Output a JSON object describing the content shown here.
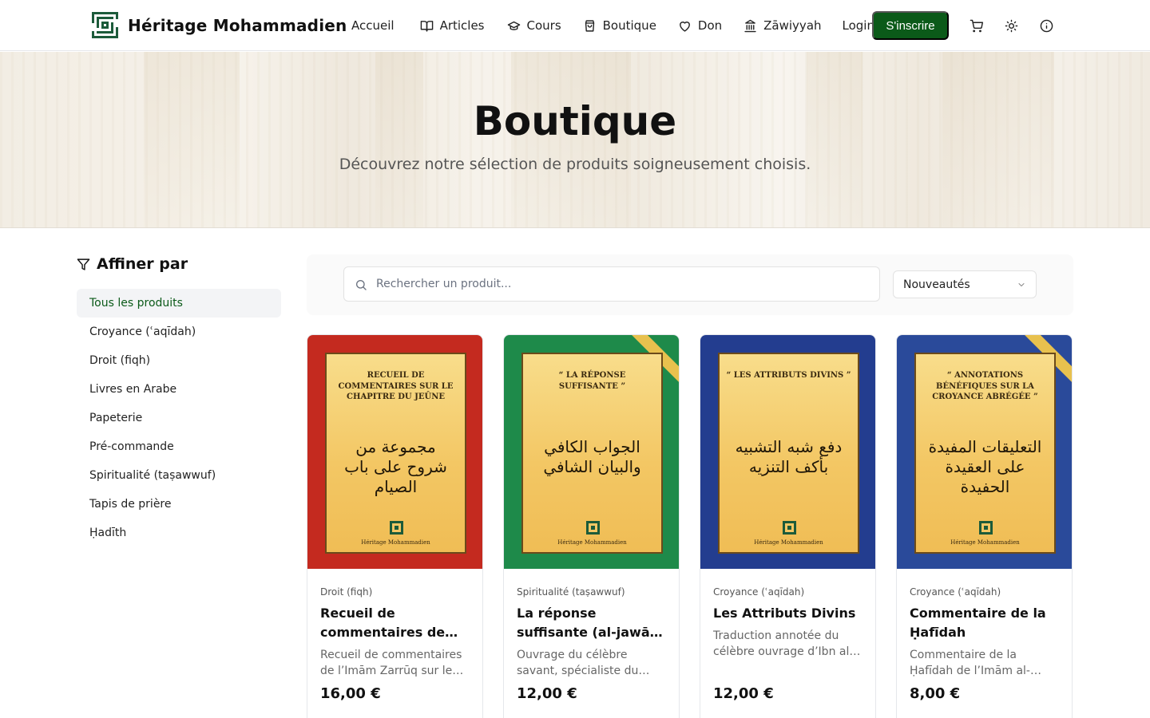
{
  "brand": {
    "name": "Héritage Mohammadien",
    "logo_icon": "kufic-square-logo"
  },
  "nav": {
    "items": [
      {
        "label": "Accueil",
        "icon": ""
      },
      {
        "label": "Articles",
        "icon": "book-open-icon"
      },
      {
        "label": "Cours",
        "icon": "graduation-cap-icon"
      },
      {
        "label": "Boutique",
        "icon": "shopping-bag-icon"
      },
      {
        "label": "Don",
        "icon": "heart-icon"
      },
      {
        "label": "Zāwiyyah",
        "icon": "landmark-icon"
      },
      {
        "label": "Login",
        "icon": ""
      }
    ],
    "signup_label": "S'inscrire",
    "icons": [
      "cart-icon",
      "sun-icon",
      "info-icon"
    ]
  },
  "hero": {
    "title": "Boutique",
    "subtitle": "Découvrez notre sélection de produits soigneusement choisis."
  },
  "sidebar": {
    "title": "Affiner par",
    "categories": [
      {
        "label": "Tous les produits",
        "active": true
      },
      {
        "label": "Croyance (ʿaqīdah)",
        "active": false
      },
      {
        "label": "Droit (fiqh)",
        "active": false
      },
      {
        "label": "Livres en Arabe",
        "active": false
      },
      {
        "label": "Papeterie",
        "active": false
      },
      {
        "label": "Pré-commande",
        "active": false
      },
      {
        "label": "Spiritualité (taṣawwuf)",
        "active": false
      },
      {
        "label": "Tapis de prière",
        "active": false
      },
      {
        "label": "Ḥadīth",
        "active": false
      }
    ]
  },
  "search": {
    "placeholder": "Rechercher un produit...",
    "value": ""
  },
  "sort": {
    "selected": "Nouveautés"
  },
  "products": [
    {
      "category": "Droit (fiqh)",
      "title": "Recueil de commentaires de l’Imām Zarrūq",
      "description": "Recueil de commentaires de l’Imām Zarrūq sur le chapitre du jeûne",
      "price": "16,00 €",
      "cover_title": "Recueil de commentaires sur le chapitre du jeûne",
      "cover_arabic": "مجموعة من شروح على باب الصيام",
      "cover_publisher": "Héritage Mohammadien",
      "cover_color": "#c42a1f"
    },
    {
      "category": "Spiritualité (taṣawwuf)",
      "title": "La réponse suffisante (al-jawāb al-kāfī)",
      "description": "Ouvrage du célèbre savant, spécialiste du soufisme",
      "price": "12,00 €",
      "cover_title": "“ La réponse suffisante ”",
      "cover_arabic": "الجواب الكافي والبيان الشافي",
      "cover_publisher": "Héritage Mohammadien",
      "cover_color": "#1e8a4a"
    },
    {
      "category": "Croyance (ʿaqīdah)",
      "title": "Les Attributs Divins",
      "description": "Traduction annotée du célèbre ouvrage d’Ibn al-Jawzī",
      "price": "12,00 €",
      "cover_title": "“ Les attributs divins ”",
      "cover_arabic": "دفع شبه التشبيه بأكف التنزيه",
      "cover_publisher": "Héritage Mohammadien",
      "cover_color": "#233d8f"
    },
    {
      "category": "Croyance (ʿaqīdah)",
      "title": "Commentaire de la Ḥafīdah",
      "description": "Commentaire de la Ḥafīdah de l’Imām al-Sanūsī",
      "price": "8,00 €",
      "cover_title": "“ Annotations bénéfiques sur la croyance abrégée ”",
      "cover_arabic": "التعليقات المفيدة على العقيدة الحفيدة",
      "cover_publisher": "Héritage Mohammadien",
      "cover_color": "#2a4a9a"
    }
  ],
  "colors": {
    "accent": "#0b5a19",
    "active_bg": "#f3f4f6"
  }
}
